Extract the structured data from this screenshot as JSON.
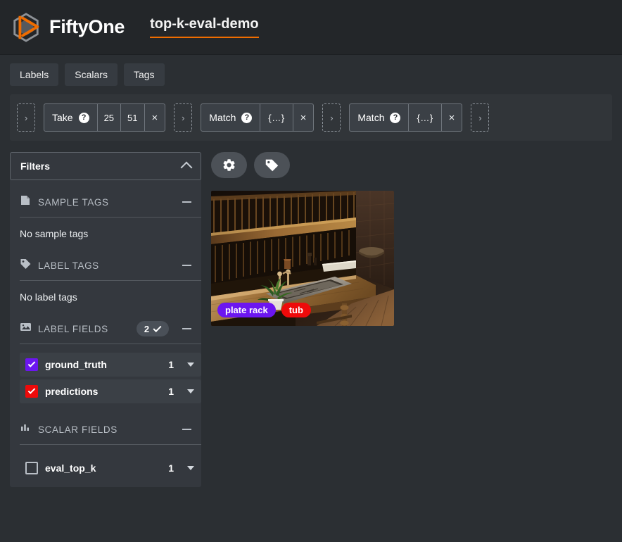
{
  "header": {
    "logo_icon": "fiftyone-logo-icon",
    "brand": "FiftyOne",
    "dataset_name": "top-k-eval-demo",
    "accent_color": "#ef6c00"
  },
  "tabs": [
    {
      "label": "Labels"
    },
    {
      "label": "Scalars"
    },
    {
      "label": "Tags"
    }
  ],
  "view_bar": {
    "add_stage_glyph": "›",
    "stages": [
      {
        "name": "Take",
        "help_glyph": "?",
        "params": [
          "25",
          "51"
        ],
        "close_glyph": "×"
      },
      {
        "name": "Match",
        "help_glyph": "?",
        "params": [
          "{…}"
        ],
        "close_glyph": "×"
      },
      {
        "name": "Match",
        "help_glyph": "?",
        "params": [
          "{…}"
        ],
        "close_glyph": "×"
      }
    ]
  },
  "sidebar": {
    "filters_label": "Filters",
    "sections": [
      {
        "key": "sample_tags",
        "icon": "page-icon",
        "title": "SAMPLE TAGS",
        "empty_text": "No sample tags",
        "collapse_glyph": "minus"
      },
      {
        "key": "label_tags",
        "icon": "tag-icon",
        "title": "LABEL TAGS",
        "empty_text": "No label tags",
        "collapse_glyph": "minus"
      },
      {
        "key": "label_fields",
        "icon": "image-icon",
        "title": "LABEL FIELDS",
        "badge_count": "2",
        "collapse_glyph": "minus"
      },
      {
        "key": "scalar_fields",
        "icon": "bar-chart-icon",
        "title": "SCALAR FIELDS",
        "collapse_glyph": "minus"
      }
    ],
    "label_fields": [
      {
        "name": "ground_truth",
        "count": "1",
        "checked": true,
        "color": "#6c16f0"
      },
      {
        "name": "predictions",
        "count": "1",
        "checked": true,
        "color": "#ee0a0a"
      }
    ],
    "scalar_fields": [
      {
        "name": "eval_top_k",
        "count": "1",
        "checked": false
      }
    ]
  },
  "main": {
    "toolbar": [
      {
        "icon": "gear-icon",
        "name": "settings-button"
      },
      {
        "icon": "tag-icon",
        "name": "tag-button"
      }
    ],
    "sample": {
      "alt": "dark rustic kitchen with wooden plate rack above a stone sink",
      "labels": [
        {
          "text": "plate rack",
          "color": "#6c16f0"
        },
        {
          "text": "tub",
          "color": "#ee0a0a"
        }
      ]
    }
  }
}
